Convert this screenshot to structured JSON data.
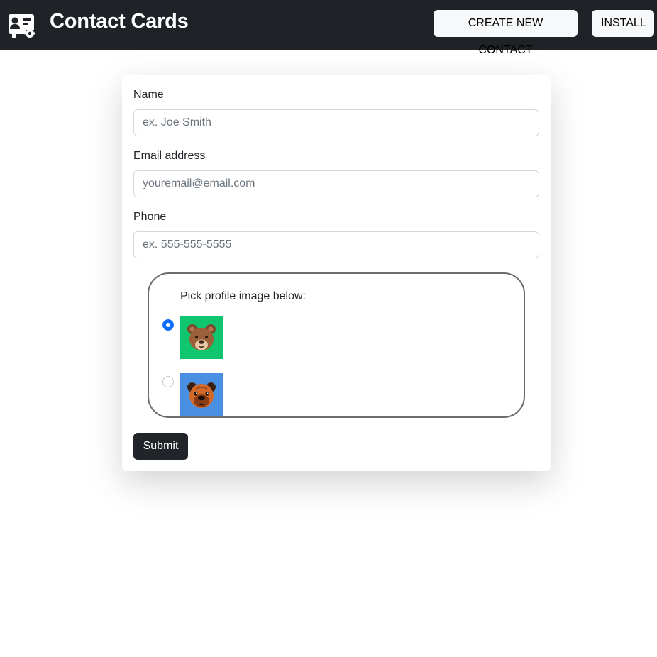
{
  "header": {
    "brand_icon": "contact-card-icon",
    "title": "Contact Cards",
    "create_button": "CREATE NEW CONTACT",
    "install_button": "INSTALL"
  },
  "form": {
    "name": {
      "label": "Name",
      "placeholder": "ex. Joe Smith",
      "value": ""
    },
    "email": {
      "label": "Email address",
      "placeholder": "youremail@email.com",
      "value": ""
    },
    "phone": {
      "label": "Phone",
      "placeholder": "ex. 555-555-5555",
      "value": ""
    },
    "profile_picker": {
      "label": "Pick profile image below:",
      "options": [
        {
          "icon": "bear-avatar-icon",
          "background": "#0fc66e",
          "selected": true
        },
        {
          "icon": "pug-avatar-icon",
          "background": "#4a90e2",
          "selected": false
        }
      ]
    },
    "submit_label": "Submit"
  },
  "colors": {
    "navbar": "#1f2327",
    "accent": "#0d6efd",
    "submit": "#212529"
  }
}
